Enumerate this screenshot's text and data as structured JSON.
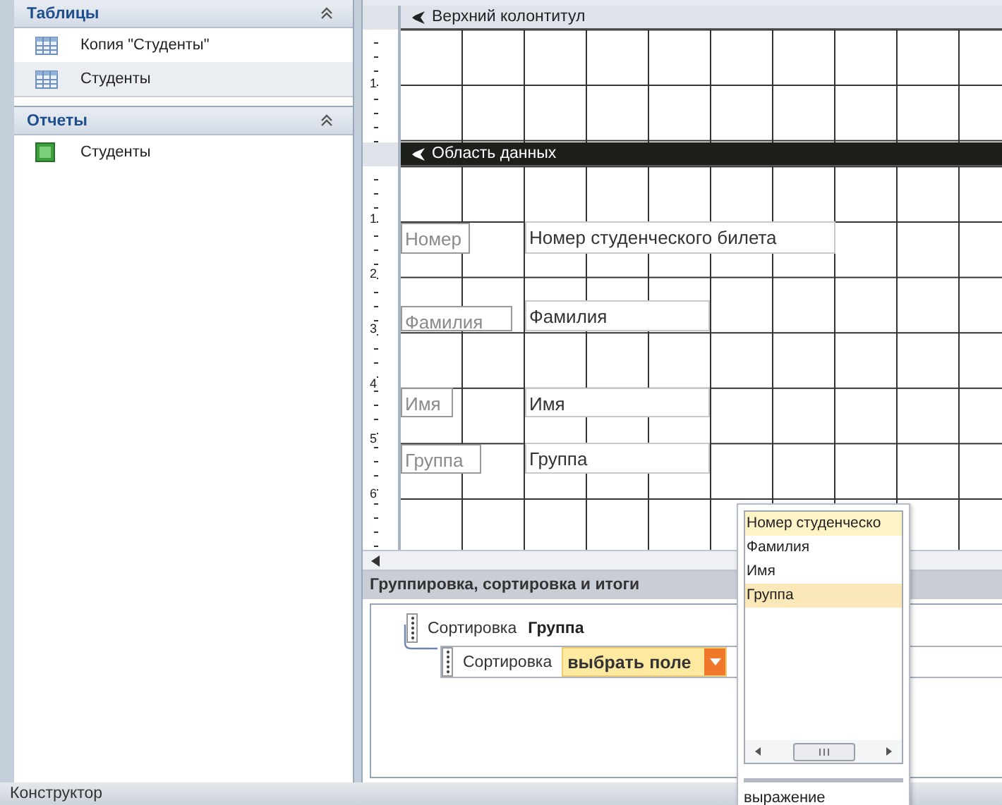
{
  "navigation": {
    "groups": [
      {
        "title": "Таблицы",
        "expanded": true,
        "items": [
          {
            "kind": "table",
            "label": "Копия \"Студенты\"",
            "selected": false
          },
          {
            "kind": "table",
            "label": "Студенты",
            "selected": true
          }
        ]
      },
      {
        "title": "Отчеты",
        "expanded": true,
        "items": [
          {
            "kind": "report",
            "label": "Студенты",
            "selected": false
          }
        ]
      }
    ]
  },
  "designer": {
    "sections": [
      {
        "title": "Верхний колонтитул",
        "selected": false,
        "ruler": [
          "1"
        ]
      },
      {
        "title": "Область данных",
        "selected": true,
        "ruler": [
          "1",
          "2",
          "3",
          "4",
          "5",
          "6"
        ],
        "controls": [
          {
            "kind": "label",
            "text": "Номер"
          },
          {
            "kind": "textbox",
            "text": "Номер студенческого билета"
          },
          {
            "kind": "label",
            "text": "Фамилия"
          },
          {
            "kind": "textbox",
            "text": "Фамилия"
          },
          {
            "kind": "label",
            "text": "Имя"
          },
          {
            "kind": "textbox",
            "text": "Имя"
          },
          {
            "kind": "label",
            "text": "Группа"
          },
          {
            "kind": "textbox",
            "text": "Группа"
          }
        ]
      }
    ]
  },
  "group_panel": {
    "title": "Группировка, сортировка и итоги",
    "levels": [
      {
        "label": "Сортировка",
        "field": "Группа"
      },
      {
        "label": "Сортировка",
        "placeholder": "выбрать поле"
      }
    ]
  },
  "field_dropdown": {
    "options": [
      {
        "label": "Номер студенческо",
        "selected": false,
        "hovered": true
      },
      {
        "label": "Фамилия",
        "selected": false,
        "hovered": false
      },
      {
        "label": "Имя",
        "selected": false,
        "hovered": false
      },
      {
        "label": "Группа",
        "selected": true,
        "hovered": false
      }
    ],
    "footer": "выражение"
  },
  "status_bar": {
    "text": "Конструктор"
  }
}
